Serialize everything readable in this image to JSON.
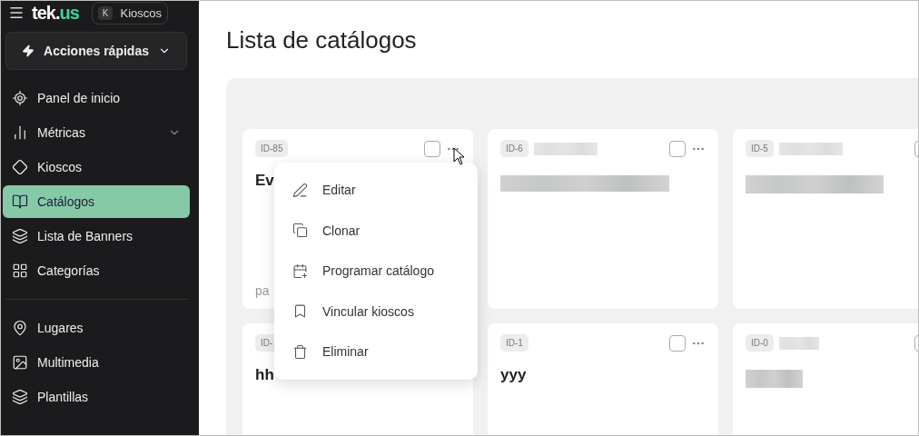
{
  "topbar": {
    "logo_main": "tek.",
    "logo_accent": "us",
    "workspace_initial": "K",
    "workspace_name": "Kioscos"
  },
  "quick_actions": {
    "label": "Acciones rápidas"
  },
  "sidebar": {
    "groups": [
      {
        "items": [
          {
            "label": "Panel de inicio",
            "selected": false,
            "has_submenu": false
          },
          {
            "label": "Métricas",
            "selected": false,
            "has_submenu": true
          },
          {
            "label": "Kioscos",
            "selected": false,
            "has_submenu": false
          },
          {
            "label": "Catálogos",
            "selected": true,
            "has_submenu": false
          },
          {
            "label": "Lista de Banners",
            "selected": false,
            "has_submenu": false
          },
          {
            "label": "Categorías",
            "selected": false,
            "has_submenu": false
          }
        ]
      },
      {
        "items": [
          {
            "label": "Lugares",
            "selected": false,
            "has_submenu": false
          },
          {
            "label": "Multimedia",
            "selected": false,
            "has_submenu": false
          },
          {
            "label": "Plantillas",
            "selected": false,
            "has_submenu": false
          }
        ]
      }
    ]
  },
  "page_title": "Lista de catálogos",
  "cards": [
    {
      "kind": "titled",
      "id": "ID-85",
      "title": "Ev",
      "footer": "pa",
      "checked": false
    },
    {
      "kind": "redacted",
      "id": "ID-6",
      "checked": false
    },
    {
      "kind": "redacted",
      "id": "ID-5",
      "checked": false
    },
    {
      "kind": "titled",
      "id": "ID-",
      "title": "hh"
    },
    {
      "kind": "titled",
      "id": "ID-1",
      "title": "yyy",
      "checked": false
    },
    {
      "kind": "redacted",
      "id": "ID-0",
      "checked": false
    }
  ],
  "context_menu": {
    "items": [
      {
        "label": "Editar"
      },
      {
        "label": "Clonar"
      },
      {
        "label": "Programar catálogo"
      },
      {
        "label": "Vincular kioscos"
      },
      {
        "label": "Eliminar"
      }
    ]
  }
}
